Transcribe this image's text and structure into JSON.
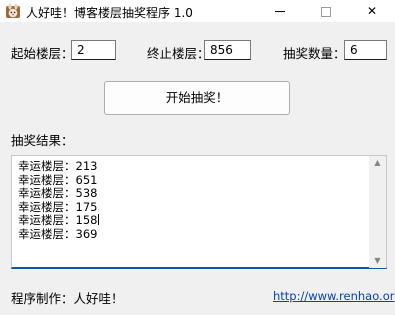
{
  "window": {
    "title": "人好哇！博客楼层抽奖程序 1.0",
    "icon": "rabbit-app-icon",
    "controls": {
      "minimize": "minimize-icon",
      "maximize": "maximize-icon",
      "close": "close-icon",
      "close_glyph": "✕"
    }
  },
  "form": {
    "start_label": "起始楼层：",
    "start_value": "2",
    "end_label": "终止楼层：",
    "end_value": "856",
    "count_label": "抽奖数量：",
    "count_value": "6"
  },
  "start_button": {
    "label": "开始抽奖！"
  },
  "results": {
    "label": "抽奖结果：",
    "lines": [
      "幸运楼层：213",
      "幸运楼层：651",
      "幸运楼层：538",
      "幸运楼层：175",
      "幸运楼层：158",
      "幸运楼层：369"
    ],
    "scroll_up_glyph": "▲",
    "scroll_down_glyph": "▼"
  },
  "footer": {
    "author": "程序制作：人好哇！",
    "link": "http://www.renhao.org"
  },
  "colors": {
    "window_bg": "#f0f0f0",
    "focus_underline": "#0a58a8",
    "link": "#0645ad"
  }
}
